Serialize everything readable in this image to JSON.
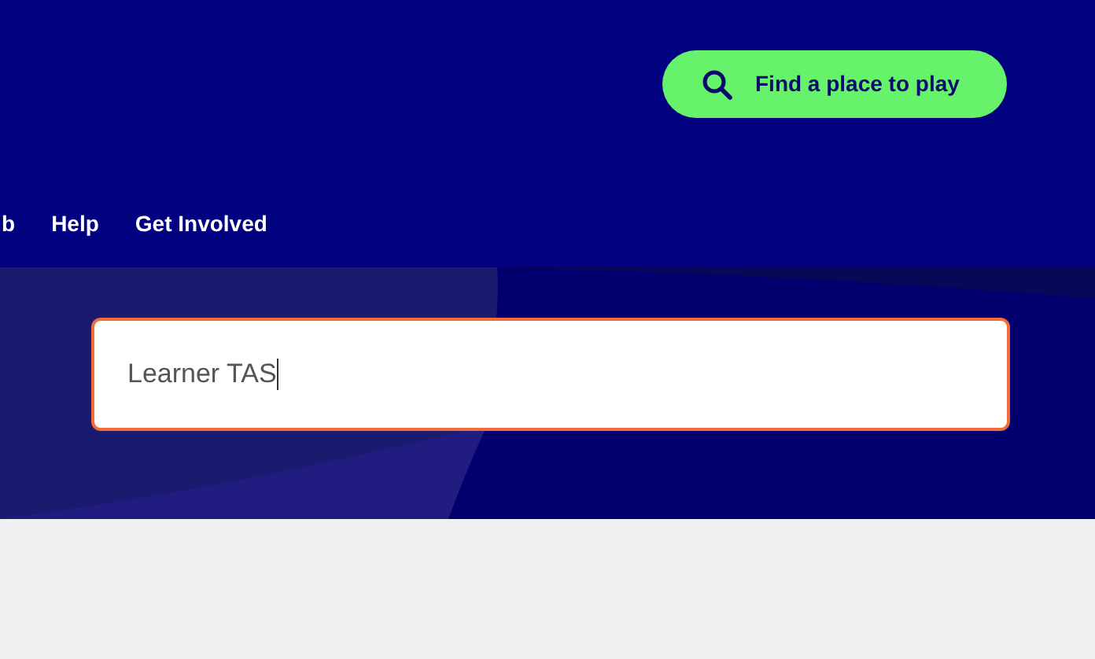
{
  "header": {
    "find_button": {
      "label": "Find a place to play"
    },
    "nav": [
      {
        "label": "b"
      },
      {
        "label": "Help"
      },
      {
        "label": "Get Involved"
      }
    ]
  },
  "search": {
    "value": "Learner TAS",
    "focused": true
  }
}
